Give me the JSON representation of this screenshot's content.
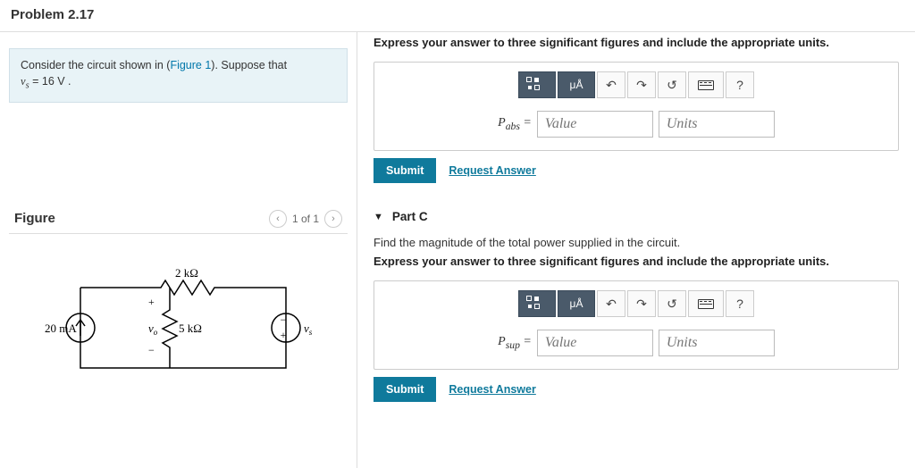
{
  "problem_title": "Problem 2.17",
  "consider": {
    "text_prefix": "Consider the circuit shown in (",
    "figure_link": "Figure 1",
    "text_suffix": "). Suppose that",
    "var": "v",
    "sub": "s",
    "equals": " = 16  V ."
  },
  "figure": {
    "label": "Figure",
    "pager_text": "1 of 1"
  },
  "circuit": {
    "current_source": "20 mA",
    "r1": "5 kΩ",
    "r2": "2 kΩ",
    "vo": "vo",
    "vs": "vs",
    "plus": "+",
    "minus": "−"
  },
  "instruction": "Express your answer to three significant figures and include the appropriate units.",
  "toolbar": {
    "units_btn": "μÅ",
    "undo": "↶",
    "redo": "↷",
    "reset": "↺",
    "help": "?"
  },
  "partB": {
    "lhs_symbol": "P",
    "lhs_sub": "abs",
    "eq": " =",
    "value_placeholder": "Value",
    "units_placeholder": "Units",
    "submit": "Submit",
    "request": "Request Answer"
  },
  "partC": {
    "header": "Part C",
    "question": "Find the magnitude of the total power supplied in the circuit.",
    "lhs_symbol": "P",
    "lhs_sub": "sup",
    "eq": " =",
    "value_placeholder": "Value",
    "units_placeholder": "Units",
    "submit": "Submit",
    "request": "Request Answer"
  }
}
